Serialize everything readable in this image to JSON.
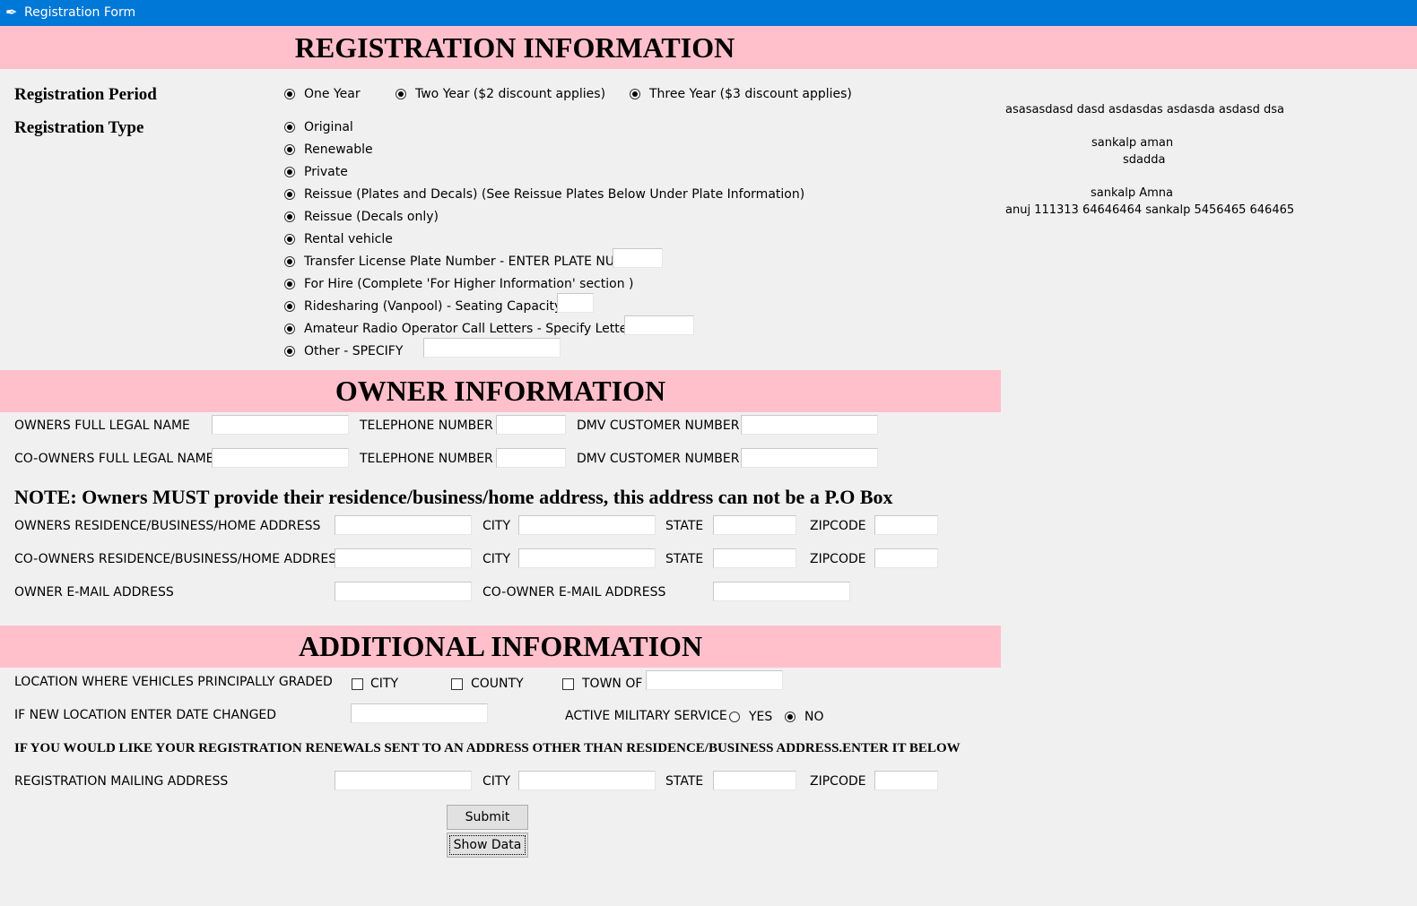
{
  "window": {
    "title": "Registration Form"
  },
  "banners": {
    "registration": "REGISTRATION INFORMATION",
    "owner": "OWNER INFORMATION",
    "additional": "ADDITIONAL INFORMATION"
  },
  "registration_period": {
    "label": "Registration Period",
    "options": [
      "One Year",
      "Two Year ($2 discount applies)",
      "Three Year ($3 discount applies)"
    ]
  },
  "registration_type": {
    "label": "Registration Type",
    "options": [
      "Original",
      "Renewable",
      "Private",
      "Reissue (Plates and Decals) (See Reissue Plates Below Under Plate Information)",
      "Reissue (Decals only)",
      "Rental vehicle",
      "Transfer License Plate Number - ENTER PLATE NUM",
      "For Hire (Complete 'For Higher Information' section )",
      "Ridesharing (Vanpool) - Seating Capacity",
      "Amateur Radio Operator Call Letters - Specify Letters",
      "Other - SPECIFY"
    ]
  },
  "side_panel": {
    "line1": "asasasdasd dasd asdasdas asdasda asdasd dsa",
    "line2": "sankalp   aman",
    "line3": "sdadda",
    "line4": "sankalp   Amna",
    "line5": "anuj 111313 64646464 sankalp 5456465 646465"
  },
  "owner": {
    "owner_name_label": "OWNERS FULL LEGAL NAME",
    "coowner_name_label": "CO-OWNERS FULL LEGAL NAME",
    "telephone_label": "TELEPHONE NUMBER",
    "dmv_label": "DMV CUSTOMER NUMBER",
    "note": "NOTE: Owners MUST provide their residence/business/home address, this address can not be a P.O Box",
    "owner_address_label": "OWNERS RESIDENCE/BUSINESS/HOME ADDRESS",
    "coowner_address_label": "CO-OWNERS RESIDENCE/BUSINESS/HOME ADDRESS",
    "city_label": "CITY",
    "state_label": "STATE",
    "zip_label": "ZIPCODE",
    "owner_email_label": "OWNER E-MAIL ADDRESS",
    "coowner_email_label": "CO-OWNER E-MAIL ADDRESS"
  },
  "additional": {
    "location_label": "LOCATION WHERE VEHICLES PRINCIPALLY GRADED",
    "city_check": "CITY",
    "county_check": "COUNTY",
    "town_check": "TOWN OF",
    "date_changed_label": "IF NEW LOCATION ENTER DATE CHANGED",
    "military_label": "ACTIVE MILITARY SERVICE",
    "yes": "YES",
    "no": "NO",
    "renewal_note": "IF YOU WOULD LIKE YOUR REGISTRATION RENEWALS SENT TO AN ADDRESS OTHER THAN RESIDENCE/BUSINESS ADDRESS.ENTER IT BELOW",
    "mailing_label": "REGISTRATION MAILING ADDRESS",
    "city_label": "CITY",
    "state_label": "STATE",
    "zip_label": "ZIPCODE"
  },
  "buttons": {
    "submit": "Submit",
    "show_data": "Show Data"
  }
}
